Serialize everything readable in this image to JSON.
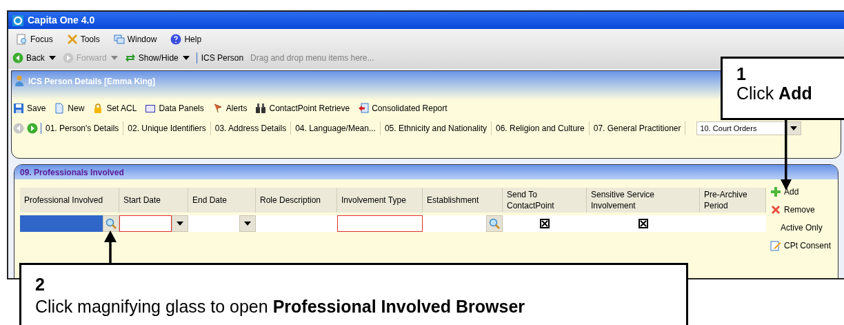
{
  "window": {
    "title": "Capita One 4.0"
  },
  "menu": [
    "Focus",
    "Tools",
    "Window",
    "Help"
  ],
  "nav": {
    "items": [
      {
        "kind": "back",
        "label": "Back",
        "disabled": false
      },
      {
        "kind": "forward",
        "label": "Forward",
        "disabled": true
      },
      {
        "kind": "showhide",
        "label": "Show/Hide",
        "disabled": false
      }
    ],
    "breadcrumb": "ICS Person",
    "hint": "Drag and drop menu items here..."
  },
  "child_window": {
    "title": "ICS Person Details [Emma King]",
    "toolbar": [
      {
        "kind": "save",
        "label": "Save"
      },
      {
        "kind": "new",
        "label": "New"
      },
      {
        "kind": "lock",
        "label": "Set ACL"
      },
      {
        "kind": "panels",
        "label": "Data Panels"
      },
      {
        "kind": "flag",
        "label": "Alerts"
      },
      {
        "kind": "binoculars",
        "label": "ContactPoint Retrieve"
      },
      {
        "kind": "report",
        "label": "Consolidated Report"
      }
    ],
    "tabs": [
      "01. Person's Details",
      "02. Unique Identifiers",
      "03. Address Details",
      "04. Language/Mean...",
      "05. Ethnicity and Nationality",
      "06. Religion and Culture",
      "07. General Practitioner"
    ],
    "tab_dropdown": "10. Court Orders"
  },
  "section": {
    "title": "09. Professionals Involved",
    "columns": [
      "Professional Involved",
      "Start Date",
      "End Date",
      "Role Description",
      "Involvement Type",
      "Establishment",
      "Send To ContactPoint",
      "Sensitive Service Involvement",
      "Pre-Archive Period"
    ],
    "row": [
      {
        "kind": "lookup",
        "selected": true,
        "required": false
      },
      {
        "kind": "date",
        "selected": false,
        "required": true
      },
      {
        "kind": "date",
        "selected": false,
        "required": false
      },
      {
        "kind": "text",
        "selected": false,
        "required": false
      },
      {
        "kind": "text",
        "selected": false,
        "required": true
      },
      {
        "kind": "lookup",
        "selected": false,
        "required": false
      },
      {
        "kind": "checkbox",
        "checked": true
      },
      {
        "kind": "checkbox",
        "checked": true
      },
      {
        "kind": "text",
        "selected": false,
        "required": false
      }
    ],
    "actions": [
      {
        "kind": "add",
        "label": "Add"
      },
      {
        "kind": "remove",
        "label": "Remove"
      },
      {
        "kind": "plain",
        "label": "Active Only"
      },
      {
        "kind": "consent",
        "label": "CPt Consent"
      }
    ]
  },
  "callouts": [
    {
      "number": "1",
      "text": "Click **Add**"
    },
    {
      "number": "2",
      "text": "Click magnifying glass to open **Professional Involved Browser**"
    }
  ]
}
